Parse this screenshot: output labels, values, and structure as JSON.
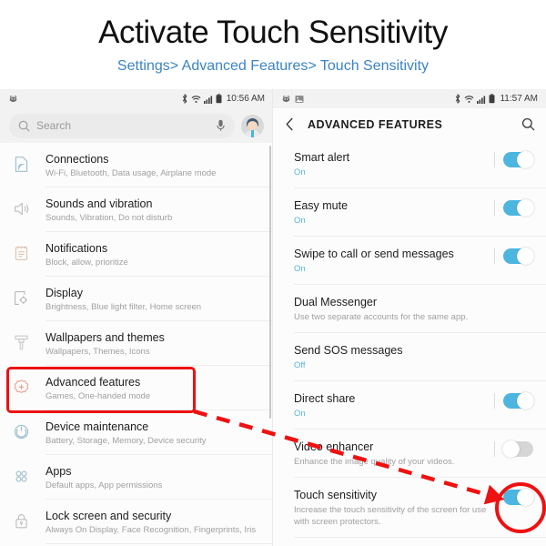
{
  "header": {
    "title": "Activate Touch Sensitivity",
    "subtitle": "Settings> Advanced Features> Touch Sensitivity",
    "subtitle_color": "#3b84c4"
  },
  "left_phone": {
    "statusbar": {
      "left_icons": [
        "app-notification-icon"
      ],
      "right_icons": [
        "bluetooth-icon",
        "wifi-icon",
        "signal-icon",
        "battery-icon"
      ],
      "time": "10:56 AM"
    },
    "search": {
      "placeholder": "Search",
      "icon": "search-icon",
      "mic_icon": "microphone-icon",
      "avatar": "user-avatar"
    },
    "items": [
      {
        "icon": "connections-icon",
        "title": "Connections",
        "subtitle": "Wi-Fi, Bluetooth, Data usage, Airplane mode",
        "highlighted": false
      },
      {
        "icon": "sound-icon",
        "title": "Sounds and vibration",
        "subtitle": "Sounds, Vibration, Do not disturb",
        "highlighted": false
      },
      {
        "icon": "notifications-icon",
        "title": "Notifications",
        "subtitle": "Block, allow, prioritize",
        "highlighted": false
      },
      {
        "icon": "display-icon",
        "title": "Display",
        "subtitle": "Brightness, Blue light filter, Home screen",
        "highlighted": false
      },
      {
        "icon": "wallpaper-icon",
        "title": "Wallpapers and themes",
        "subtitle": "Wallpapers, Themes, Icons",
        "highlighted": false
      },
      {
        "icon": "advanced-features-icon",
        "title": "Advanced features",
        "subtitle": "Games, One-handed mode",
        "highlighted": true
      },
      {
        "icon": "device-maintenance-icon",
        "title": "Device maintenance",
        "subtitle": "Battery, Storage, Memory, Device security",
        "highlighted": false
      },
      {
        "icon": "apps-icon",
        "title": "Apps",
        "subtitle": "Default apps, App permissions",
        "highlighted": false
      },
      {
        "icon": "lock-icon",
        "title": "Lock screen and security",
        "subtitle": "Always On Display, Face Recognition, Fingerprints, Iris",
        "highlighted": false
      }
    ]
  },
  "right_phone": {
    "statusbar": {
      "left_icons": [
        "app-notification-icon",
        "screenshot-icon"
      ],
      "right_icons": [
        "bluetooth-icon",
        "wifi-icon",
        "signal-icon",
        "battery-icon"
      ],
      "time": "11:57 AM"
    },
    "appbar": {
      "back_icon": "back-chevron-icon",
      "title": "ADVANCED FEATURES",
      "search_icon": "search-icon"
    },
    "items": [
      {
        "title": "Smart alert",
        "subtitle": "On",
        "subtitle_is_state": true,
        "toggle": "on"
      },
      {
        "title": "Easy mute",
        "subtitle": "On",
        "subtitle_is_state": true,
        "toggle": "on"
      },
      {
        "title": "Swipe to call or send messages",
        "subtitle": "On",
        "subtitle_is_state": true,
        "toggle": "on"
      },
      {
        "title": "Dual Messenger",
        "subtitle": "Use two separate accounts for the same app.",
        "subtitle_is_state": false,
        "toggle": "none"
      },
      {
        "title": "Send SOS messages",
        "subtitle": "Off",
        "subtitle_is_state": true,
        "toggle": "none"
      },
      {
        "title": "Direct share",
        "subtitle": "On",
        "subtitle_is_state": true,
        "toggle": "on"
      },
      {
        "title": "Video enhancer",
        "subtitle": "Enhance the image quality of your videos.",
        "subtitle_is_state": false,
        "toggle": "off"
      },
      {
        "title": "Touch sensitivity",
        "subtitle": "Increase the touch sensitivity of the screen for use with screen protectors.",
        "subtitle_is_state": false,
        "toggle": "on"
      }
    ]
  },
  "annotations": {
    "color": "#ee1111",
    "highlight_box_target": "Advanced features",
    "circle_target": "Touch sensitivity toggle",
    "arrow": "dashed-arrow-from-advanced-features-to-touch-sensitivity-toggle"
  }
}
